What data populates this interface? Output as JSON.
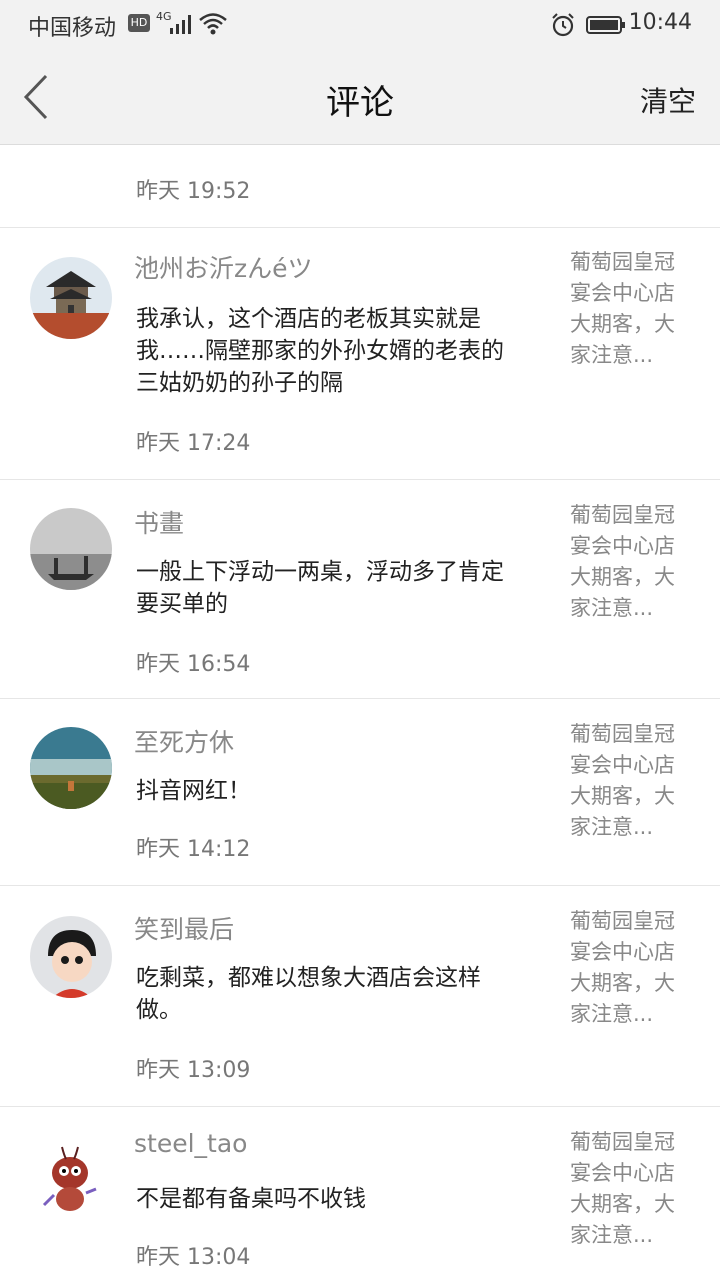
{
  "status_bar": {
    "carrier": "中国移动",
    "hd_label": "HD",
    "network": "4G",
    "time": "10:44"
  },
  "nav": {
    "title": "评论",
    "clear_label": "清空"
  },
  "top_item": {
    "time": "昨天 19:52"
  },
  "comments": [
    {
      "name": "池州お沂zんéツ",
      "text": "我承认，这个酒店的老板其实就是我……隔壁那家的外孙女婿的老表的三姑奶奶的孙子的隔",
      "time": "昨天 17:24",
      "side": "葡萄园皇冠宴会中心店大期客，大家注意..."
    },
    {
      "name": "书畫",
      "text": "一般上下浮动一两桌，浮动多了肯定要买单的",
      "time": "昨天 16:54",
      "side": "葡萄园皇冠宴会中心店大期客，大家注意..."
    },
    {
      "name": "至死方休",
      "text": "抖音网红！",
      "time": "昨天 14:12",
      "side": "葡萄园皇冠宴会中心店大期客，大家注意..."
    },
    {
      "name": "笑到最后",
      "text": "吃剩菜，都难以想象大酒店会这样做。",
      "time": "昨天 13:09",
      "side": "葡萄园皇冠宴会中心店大期客，大家注意..."
    },
    {
      "name": "steel_tao",
      "text": "不是都有备桌吗不收钱",
      "time": "昨天 13:04",
      "side": "葡萄园皇冠宴会中心店大期客，大家注意..."
    }
  ]
}
